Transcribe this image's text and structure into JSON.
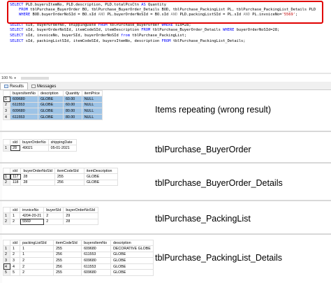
{
  "editor": {
    "lines": [
      {
        "parts": [
          [
            "kw",
            "SELECT "
          ],
          [
            "t",
            "PLD.buyersItemNo, PLD.description, PLD.totalPcsCtn "
          ],
          [
            "kw",
            "AS "
          ],
          [
            "t",
            "Quantity"
          ]
        ]
      },
      {
        "parts": [
          [
            "kw",
            "    FROM "
          ],
          [
            "t",
            "tblPurchase_BuyerOrder BO, tblPurchase_BuyerOrder_Details BOD, tblPurchase_PackingList PL, tblPurchase_PackingList_Details PLD"
          ]
        ]
      },
      {
        "parts": [
          [
            "kw",
            "    WHERE "
          ],
          [
            "t",
            "BOD.buyerOrderNoSId = BO.sId "
          ],
          [
            "gray",
            "AND "
          ],
          [
            "t",
            "PL.buyerOrderNoSId = BO.sId "
          ],
          [
            "gray",
            "AND "
          ],
          [
            "t",
            "PLD.packingListSId = PL.sId "
          ],
          [
            "gray",
            "AND "
          ],
          [
            "t",
            "PL.invoiceNo="
          ],
          [
            "str",
            "'5569'"
          ],
          [
            "t",
            ";"
          ]
        ]
      },
      {
        "parts": [
          [
            "t",
            ""
          ]
        ]
      },
      {
        "parts": [
          [
            "kw",
            "SELECT "
          ],
          [
            "t",
            "sId, buyerOrderNo, shippingDate "
          ],
          [
            "kw",
            "FROM "
          ],
          [
            "t",
            "tblPurchase_BuyerOrder "
          ],
          [
            "kw",
            "WHERE "
          ],
          [
            "t",
            "sId=28;"
          ]
        ]
      },
      {
        "parts": [
          [
            "kw",
            "SELECT "
          ],
          [
            "t",
            "sId, buyerOrderNoSId, itemCodeSId, itemDescription "
          ],
          [
            "kw",
            "FROM "
          ],
          [
            "t",
            "tblPurchase_BuyerOrder_Details "
          ],
          [
            "kw",
            "WHERE "
          ],
          [
            "t",
            "buyerOrderNoSId=28;"
          ]
        ]
      },
      {
        "parts": [
          [
            "kw",
            "SELECT "
          ],
          [
            "t",
            "sId, invoiceNo, buyerSId, buyerOrderNoSId "
          ],
          [
            "kw",
            "from "
          ],
          [
            "t",
            "tblPurchase_PackingList;"
          ]
        ]
      },
      {
        "parts": [
          [
            "kw",
            "SELECT "
          ],
          [
            "t",
            "sId, packingListSId, itemCodeSId, buyersItemNo, description "
          ],
          [
            "kw",
            "FROM "
          ],
          [
            "t",
            "tblPurchase_PackingList_Details;"
          ]
        ]
      }
    ]
  },
  "zoom": {
    "value": "100 %"
  },
  "tabs": [
    {
      "label": "Results",
      "icon": "results-grid-icon"
    },
    {
      "label": "Messages",
      "icon": "messages-icon"
    }
  ],
  "grids": [
    {
      "id": "grid1",
      "caption": "Items repeating (wrong result)",
      "columns": [
        "",
        "buyersItemNo",
        "description",
        "Quantity",
        "itemPrice"
      ],
      "rows": [
        [
          "1",
          "609680",
          "GLOBE",
          "60.00",
          "NULL"
        ],
        [
          "2",
          "611553",
          "GLOBE",
          "60.00",
          "NULL"
        ],
        [
          "3",
          "609680",
          "GLOBE",
          "80.00",
          "NULL"
        ],
        [
          "4",
          "611553",
          "GLOBE",
          "80.00",
          "NULL"
        ]
      ]
    },
    {
      "id": "grid2",
      "caption": "tblPurchase_BuyerOrder",
      "columns": [
        "",
        "sId",
        "buyerOrderNo",
        "shippingDate"
      ],
      "rows": [
        [
          "1",
          "28",
          "49021",
          "05-01-2021"
        ]
      ]
    },
    {
      "id": "grid3",
      "caption": "tblPurchase_BuyerOrder_Details",
      "columns": [
        "",
        "sId",
        "buyerOrderNoSId",
        "itemCodeSId",
        "itemDescription"
      ],
      "rows": [
        [
          "1",
          "117",
          "28",
          "255",
          "GLOBE"
        ],
        [
          "2",
          "118",
          "28",
          "256",
          "GLOBE"
        ]
      ]
    },
    {
      "id": "grid4",
      "caption": "tblPurchase_PackingList",
      "columns": [
        "",
        "sId",
        "invoiceNo",
        "buyerSId",
        "buyerOrderNoSId"
      ],
      "rows": [
        [
          "1",
          "1",
          "4204-20-21",
          "2",
          "29"
        ],
        [
          "2",
          "2",
          "5569",
          "2",
          "28"
        ]
      ]
    },
    {
      "id": "grid5",
      "caption": "tblPurchase_PackingList_Details",
      "columns": [
        "",
        "sId",
        "packingListSId",
        "itemCodeSId",
        "buyersItemNo",
        "description"
      ],
      "rows": [
        [
          "1",
          "1",
          "1",
          "255",
          "609680",
          "DECORATIVE GLOBE"
        ],
        [
          "2",
          "2",
          "1",
          "256",
          "611553",
          "GLOBE"
        ],
        [
          "3",
          "3",
          "2",
          "255",
          "609680",
          "GLOBE"
        ],
        [
          "4",
          "4",
          "2",
          "256",
          "611553",
          "GLOBE"
        ],
        [
          "5",
          "5",
          "2",
          "255",
          "609680",
          "GLOBE"
        ]
      ]
    }
  ]
}
